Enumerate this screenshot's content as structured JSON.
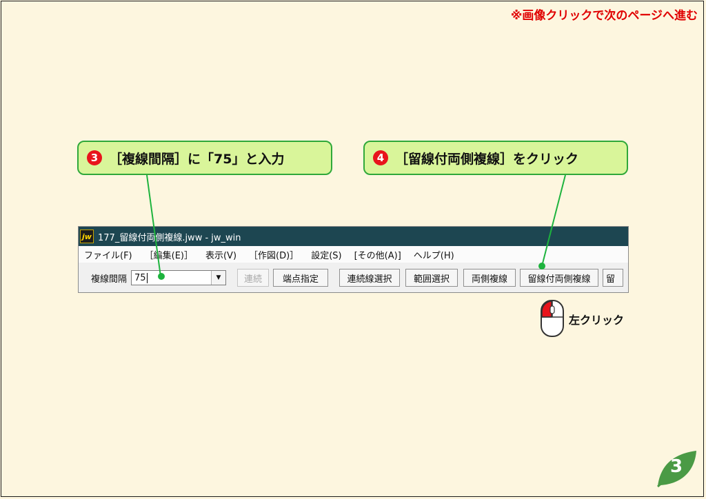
{
  "top_note": "※画像クリックで次のページへ進む",
  "callouts": {
    "step3": {
      "num": "3",
      "text": "［複線間隔］に「75」と入力"
    },
    "step4": {
      "num": "4",
      "text": "［留線付両側複線］をクリック"
    }
  },
  "window": {
    "icon_text": "jw",
    "title": "177_留線付両側複線.jww - jw_win",
    "menu": [
      "ファイル(F)",
      "［編集(E)］",
      "表示(V)",
      "［作図(D)］",
      "設定(S)",
      "[その他(A)]",
      "ヘルプ(H)"
    ],
    "toolbar": {
      "label": "複線間隔",
      "combo_value": "75",
      "buttons": [
        "連続",
        "端点指定",
        "連続線選択",
        "範囲選択",
        "両側複線",
        "留線付両側複線",
        "留"
      ]
    }
  },
  "mouse_hint": "左クリック",
  "page_number": "3",
  "colors": {
    "callout_fill": "#d9f59a",
    "callout_border": "#2fa83a",
    "number_badge": "#e8141c",
    "titlebar": "#1d4651"
  }
}
